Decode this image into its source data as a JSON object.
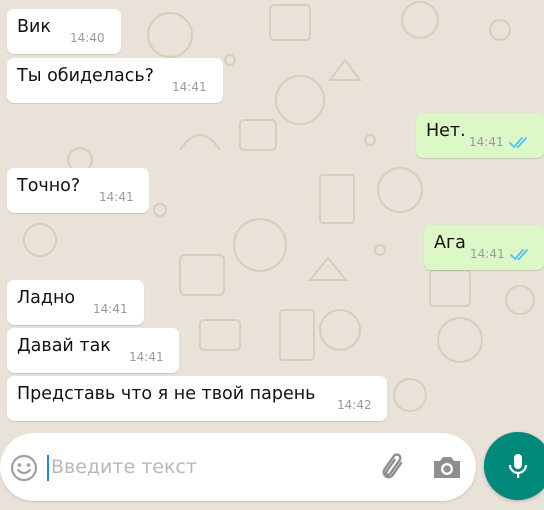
{
  "messages": [
    {
      "direction": "in",
      "text": "Вик",
      "time": "14:40"
    },
    {
      "direction": "in",
      "text": "Ты обиделась?",
      "time": "14:41"
    },
    {
      "direction": "out",
      "text": "Нет.",
      "time": "14:41",
      "status": "read"
    },
    {
      "direction": "in",
      "text": "Точно?",
      "time": "14:41"
    },
    {
      "direction": "out",
      "text": "Ага",
      "time": "14:41",
      "status": "read"
    },
    {
      "direction": "in",
      "text": "Ладно",
      "time": "14:41"
    },
    {
      "direction": "in",
      "text": "Давай так",
      "time": "14:41"
    },
    {
      "direction": "in",
      "text": "Представь что я не твой парень",
      "time": "14:42"
    }
  ],
  "composer": {
    "placeholder": "Введите текст",
    "emoji_icon": "smiley-icon",
    "attach_icon": "paperclip-icon",
    "camera_icon": "camera-icon",
    "mic_icon": "microphone-icon"
  },
  "colors": {
    "wallpaper": "#e9e2d8",
    "incoming_bubble": "#ffffff",
    "outgoing_bubble": "#dcf8c6",
    "read_ticks": "#4fc3f7",
    "mic_button": "#00897b"
  }
}
